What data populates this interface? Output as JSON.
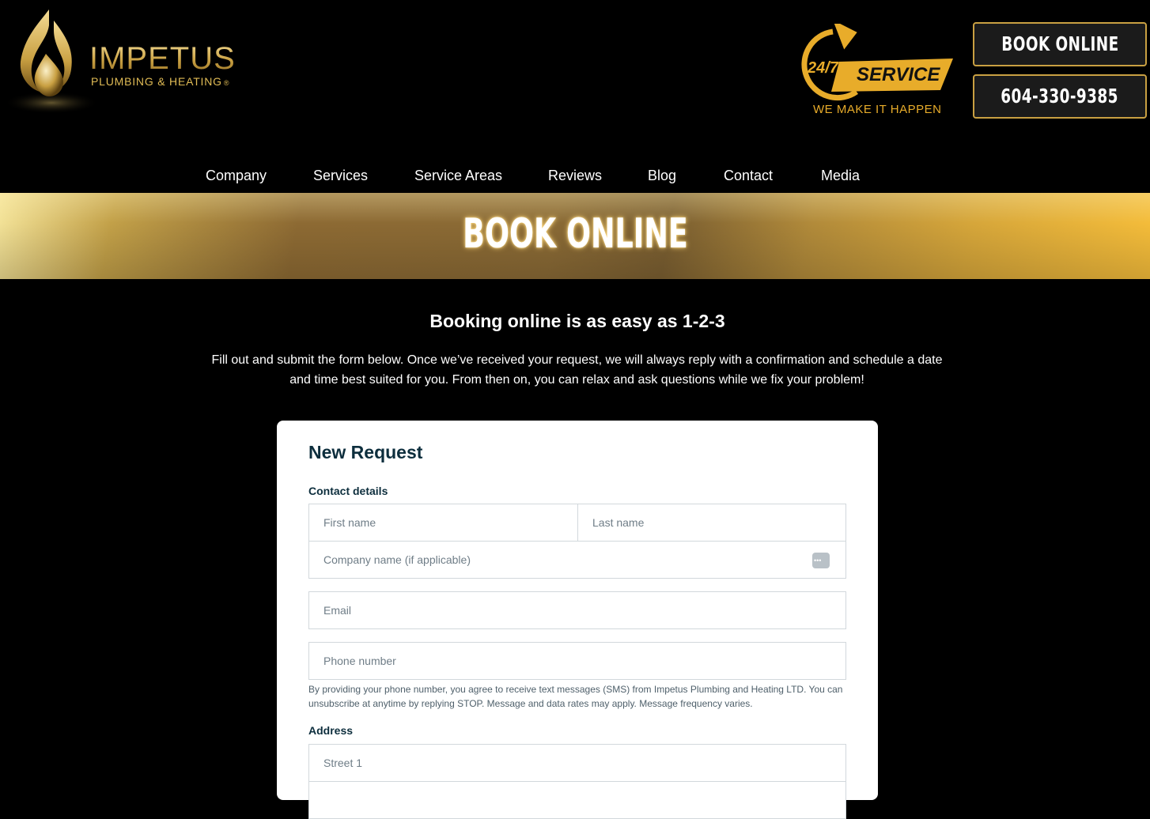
{
  "header": {
    "logo": {
      "name": "IMPETUS",
      "tagline": "PLUMBING & HEATING",
      "mark": "®"
    },
    "badge": {
      "hours": "24/7",
      "label": "SERVICE",
      "tagline": "WE MAKE IT HAPPEN"
    },
    "book_button": "BOOK ONLINE",
    "phone_button": "604-330-9385"
  },
  "nav": {
    "items": [
      "Company",
      "Services",
      "Service Areas",
      "Reviews",
      "Blog",
      "Contact",
      "Media"
    ]
  },
  "banner": {
    "title": "BOOK ONLINE"
  },
  "intro": {
    "heading": "Booking online is as easy as 1-2-3",
    "body": "Fill out and submit the form below. Once we’ve received your request, we will always reply with a confirmation and schedule a date and time best suited for you. From then on, you can relax and ask questions while we fix your problem!"
  },
  "form": {
    "title": "New Request",
    "contact_label": "Contact details",
    "first_name": {
      "placeholder": "First name",
      "value": ""
    },
    "last_name": {
      "placeholder": "Last name",
      "value": ""
    },
    "company": {
      "placeholder": "Company name (if applicable)",
      "value": ""
    },
    "email": {
      "placeholder": "Email",
      "value": ""
    },
    "phone": {
      "placeholder": "Phone number",
      "value": ""
    },
    "sms_note": "By providing your phone number, you agree to receive text messages (SMS) from Impetus Plumbing and Heating LTD. You can unsubscribe at anytime by replying STOP. Message and data rates may apply. Message frequency varies.",
    "address_label": "Address",
    "street1": {
      "placeholder": "Street 1",
      "value": ""
    }
  },
  "colors": {
    "gold": "#c9a042",
    "badge_orange": "#e8ac2a",
    "form_text": "#0d2e3d",
    "background": "#000000"
  }
}
